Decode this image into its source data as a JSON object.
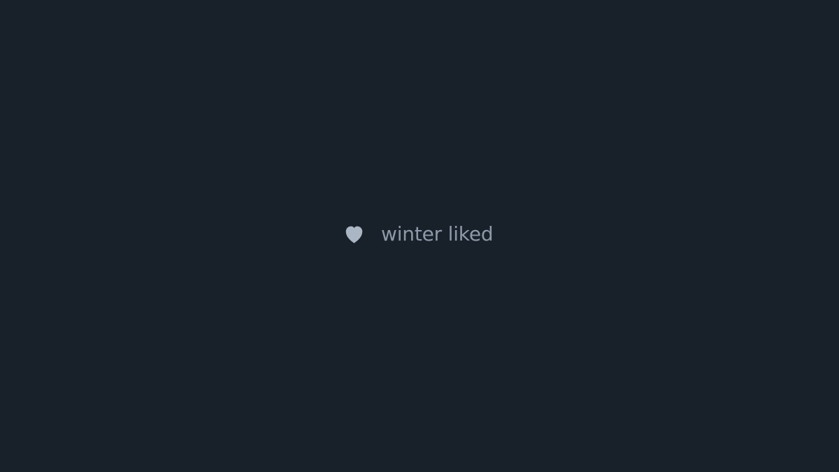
{
  "colors": {
    "background": "#18202a",
    "heart": "#aab6c3",
    "text": "#8d99a8"
  },
  "activity": {
    "icon": "heart-icon",
    "text": "winter liked"
  }
}
